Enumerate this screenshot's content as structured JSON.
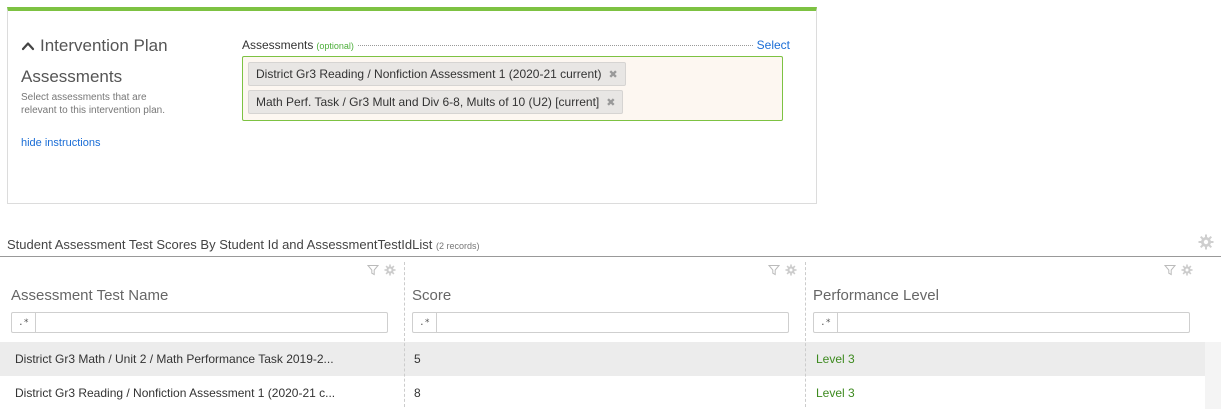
{
  "intervention": {
    "title_line1": "Intervention Plan",
    "title_line2": "Assessments",
    "instructions": "Select assessments that are relevant to this intervention plan.",
    "hide_link": "hide instructions"
  },
  "assessments": {
    "label": "Assessments",
    "optional": "(optional)",
    "select_label": "Select",
    "chips": [
      {
        "label": "District Gr3 Reading / Nonfiction Assessment 1 (2020-21 current)",
        "remove": "✖"
      },
      {
        "label": "Math Perf. Task / Gr3 Mult and Div 6-8, Mults of 10 (U2) [current]",
        "remove": "✖"
      }
    ]
  },
  "grid": {
    "title": "Student Assessment Test Scores By Student Id and AssessmentTestIdList",
    "count": "(2 records)",
    "columns": [
      {
        "name": "Assessment Test Name",
        "filter_op": ".*"
      },
      {
        "name": "Score",
        "filter_op": ".*"
      },
      {
        "name": "Performance Level",
        "filter_op": ".*"
      }
    ],
    "rows": [
      {
        "name": "District Gr3 Math / Unit 2 / Math Performance Task 2019-2...",
        "score": "5",
        "level": "Level 3"
      },
      {
        "name": "District Gr3 Reading / Nonfiction Assessment 1 (2020-21 c...",
        "score": "8",
        "level": "Level 3"
      }
    ]
  },
  "colors": {
    "accent_green": "#7dc242",
    "link_blue": "#1a6dd6",
    "level_green": "#3d8a1f"
  }
}
